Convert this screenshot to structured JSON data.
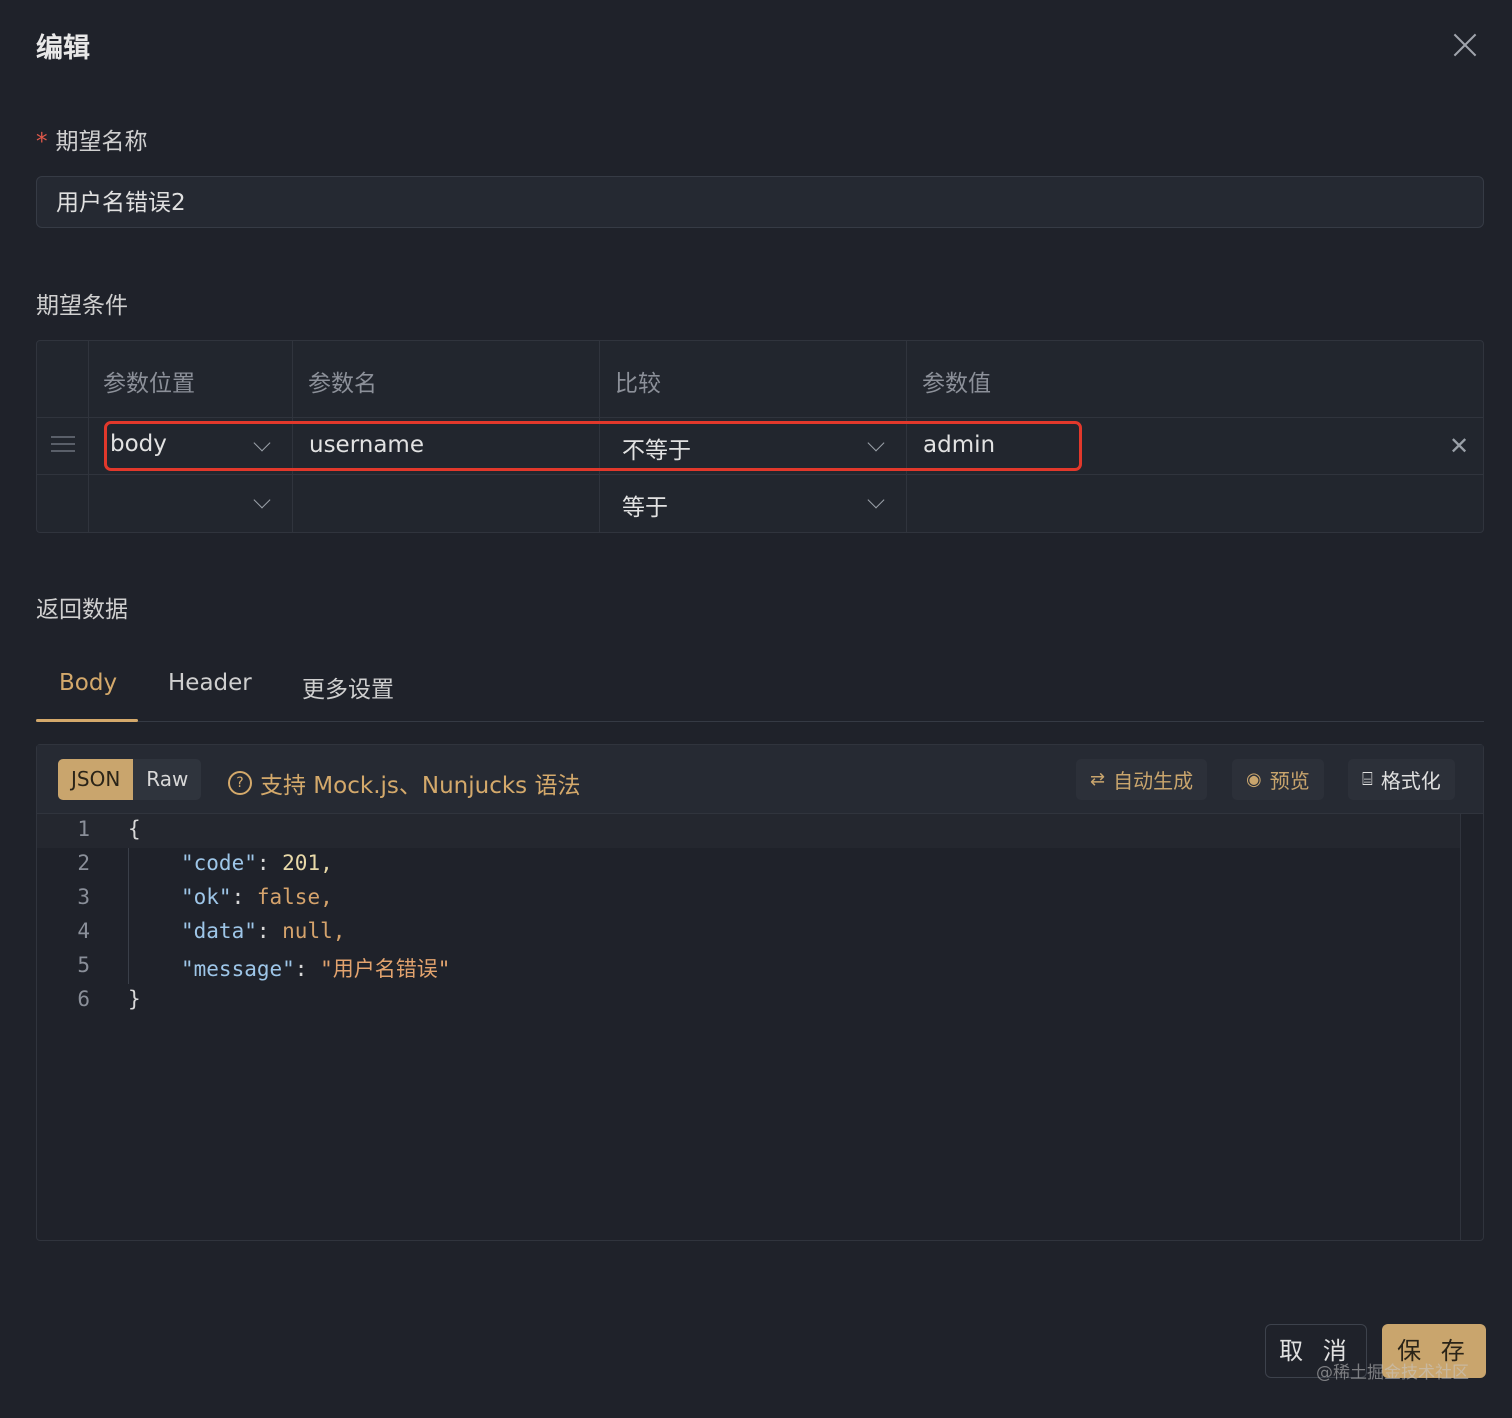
{
  "dialog": {
    "title": "编辑"
  },
  "name_field": {
    "label": "期望名称",
    "required_mark": "*",
    "value": "用户名错误2"
  },
  "conditions": {
    "label": "期望条件",
    "headers": [
      "参数位置",
      "参数名",
      "比较",
      "参数值"
    ],
    "rows": [
      {
        "position": "body",
        "name": "username",
        "compare": "不等于",
        "value": "admin"
      },
      {
        "position": "",
        "name": "",
        "compare": "等于",
        "value": ""
      }
    ],
    "delete_icon": "close-icon"
  },
  "response": {
    "label": "返回数据",
    "tabs": [
      "Body",
      "Header",
      "更多设置"
    ],
    "active_tab": "Body",
    "format_toggle": [
      "JSON",
      "Raw"
    ],
    "active_format": "JSON",
    "hint": "支持 Mock.js、Nunjucks 语法",
    "actions": [
      "自动生成",
      "预览",
      "格式化"
    ],
    "code_lines": [
      {
        "n": "1",
        "text": "{"
      },
      {
        "n": "2",
        "key": "\"code\"",
        "value": "201,"
      },
      {
        "n": "3",
        "key": "\"ok\"",
        "value": "false,"
      },
      {
        "n": "4",
        "key": "\"data\"",
        "value": "null,"
      },
      {
        "n": "5",
        "key": "\"message\"",
        "value": "\"用户名错误\""
      },
      {
        "n": "6",
        "text": "}"
      }
    ]
  },
  "footer": {
    "cancel": "取 消",
    "save": "保 存"
  },
  "watermark": "@稀土掘金技术社区",
  "colors": {
    "accent": "#c9a56d",
    "highlight": "#e2382b",
    "background": "#1f222a"
  }
}
